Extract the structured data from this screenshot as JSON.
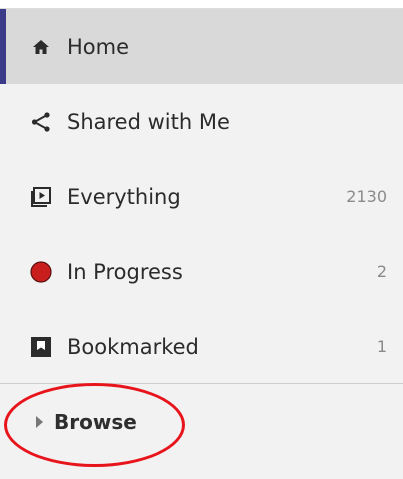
{
  "nav": {
    "items": [
      {
        "label": "Home",
        "count": "",
        "icon": "home-icon",
        "active": true
      },
      {
        "label": "Shared with Me",
        "count": "",
        "icon": "share-icon",
        "active": false
      },
      {
        "label": "Everything",
        "count": "2130",
        "icon": "video-list-icon",
        "active": false
      },
      {
        "label": "In Progress",
        "count": "2",
        "icon": "record-dot-icon",
        "active": false
      },
      {
        "label": "Bookmarked",
        "count": "1",
        "icon": "bookmark-icon",
        "active": false
      }
    ]
  },
  "browse": {
    "label": "Browse",
    "icon": "caret-right-icon"
  },
  "colors": {
    "active_bg": "#d9d9d9",
    "active_accent": "#3b3b8a",
    "panel_bg": "#f2f2f2",
    "in_progress_dot": "#c81e1e",
    "annotation_circle": "#e8141c"
  }
}
